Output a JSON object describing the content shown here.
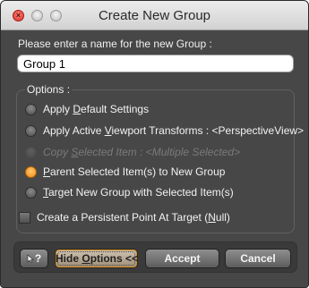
{
  "window": {
    "title": "Create New Group",
    "close_glyph": "×"
  },
  "form": {
    "prompt": "Please enter a name for the new Group :",
    "name_value": "Group 1",
    "options_label": "Options :"
  },
  "options": [
    {
      "pre": "Apply ",
      "u": "D",
      "post": "efault Settings",
      "checked": false,
      "disabled": false
    },
    {
      "pre": "Apply Active ",
      "u": "V",
      "post": "iewport Transforms : <PerspectiveView>",
      "checked": false,
      "disabled": false
    },
    {
      "pre": "Copy ",
      "u": "S",
      "post": "elected Item : <Multiple Selected>",
      "checked": false,
      "disabled": true
    },
    {
      "pre": "",
      "u": "P",
      "post": "arent Selected Item(s) to New Group",
      "checked": true,
      "disabled": false
    },
    {
      "pre": "",
      "u": "T",
      "post": "arget New Group with Selected Item(s)",
      "checked": false,
      "disabled": false
    }
  ],
  "checkbox": {
    "pre": "Create a Persistent Point At Target (",
    "u": "N",
    "post": "ull)",
    "checked": false
  },
  "buttons": {
    "help_label": "?",
    "hide_pre": "Hide ",
    "hide_u": "O",
    "hide_post": "ptions <<",
    "accept": "Accept",
    "cancel": "Cancel"
  },
  "colors": {
    "accent": "#f08a0c",
    "window_bg": "#474747"
  }
}
